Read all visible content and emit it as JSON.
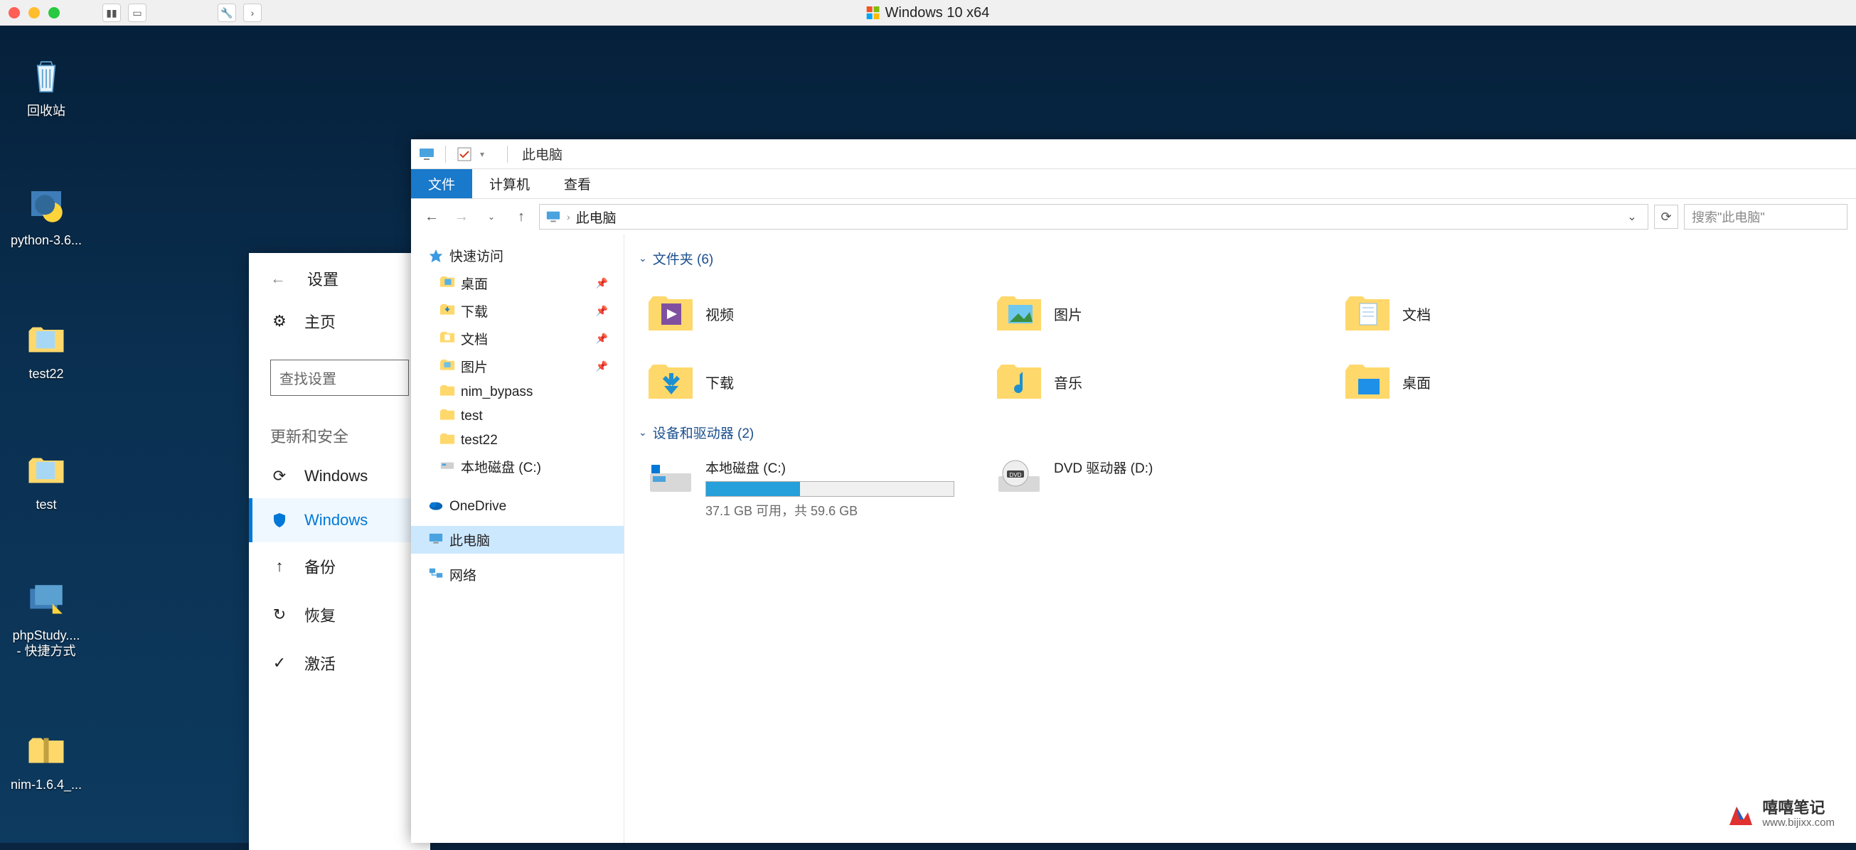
{
  "mac": {
    "title": "Windows 10 x64"
  },
  "desktop": {
    "icons": [
      {
        "label": "回收站"
      },
      {
        "label": "python-3.6..."
      },
      {
        "label": "test22"
      },
      {
        "label": "test"
      },
      {
        "label": "phpStudy....",
        "label2": "- 快捷方式"
      },
      {
        "label": "nim-1.6.4_..."
      }
    ]
  },
  "settings": {
    "title": "设置",
    "search_placeholder": "查找设置",
    "home": "主页",
    "section": "更新和安全",
    "items": [
      {
        "label": "Windows"
      },
      {
        "label": "Windows"
      },
      {
        "label": "备份"
      },
      {
        "label": "恢复"
      },
      {
        "label": "激活"
      }
    ]
  },
  "explorer": {
    "title": "此电脑",
    "tabs": {
      "file": "文件",
      "computer": "计算机",
      "view": "查看"
    },
    "breadcrumb": "此电脑",
    "search_placeholder": "搜索\"此电脑\"",
    "nav": {
      "quick": "快速访问",
      "quick_items": [
        {
          "label": "桌面"
        },
        {
          "label": "下载"
        },
        {
          "label": "文档"
        },
        {
          "label": "图片"
        },
        {
          "label": "nim_bypass"
        },
        {
          "label": "test"
        },
        {
          "label": "test22"
        },
        {
          "label": "本地磁盘 (C:)"
        }
      ],
      "onedrive": "OneDrive",
      "thispc": "此电脑",
      "network": "网络"
    },
    "groups": {
      "folders": {
        "title": "文件夹 (6)"
      },
      "devices": {
        "title": "设备和驱动器 (2)"
      }
    },
    "folders": [
      {
        "name": "视频"
      },
      {
        "name": "图片"
      },
      {
        "name": "文档"
      },
      {
        "name": "下载"
      },
      {
        "name": "音乐"
      },
      {
        "name": "桌面"
      }
    ],
    "drives": {
      "c": {
        "name": "本地磁盘 (C:)",
        "free": "37.1 GB 可用，共 59.6 GB",
        "fill_percent": 38
      },
      "d": {
        "name": "DVD 驱动器 (D:)"
      }
    }
  },
  "watermark": {
    "text": "嘻嘻笔记",
    "url": "www.bijixx.com"
  }
}
